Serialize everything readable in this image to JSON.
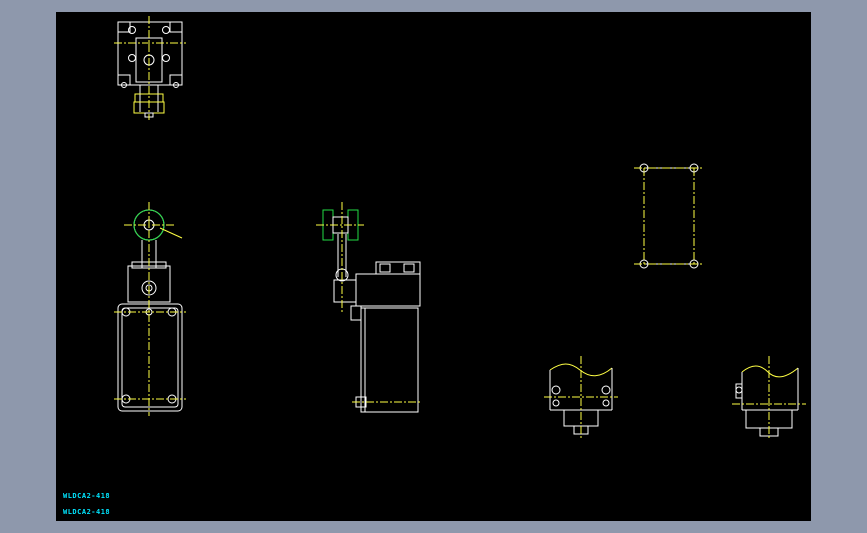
{
  "viewport": {
    "background": "#8e98ac",
    "canvas_background": "#000000"
  },
  "colors": {
    "outline": "#ffffff",
    "centerline": "#ffff44",
    "roller": "#22dd44",
    "text": "#00e5ff"
  },
  "labels": {
    "line1": "WLDCA2-418",
    "line2": "WLDCA2-418"
  }
}
